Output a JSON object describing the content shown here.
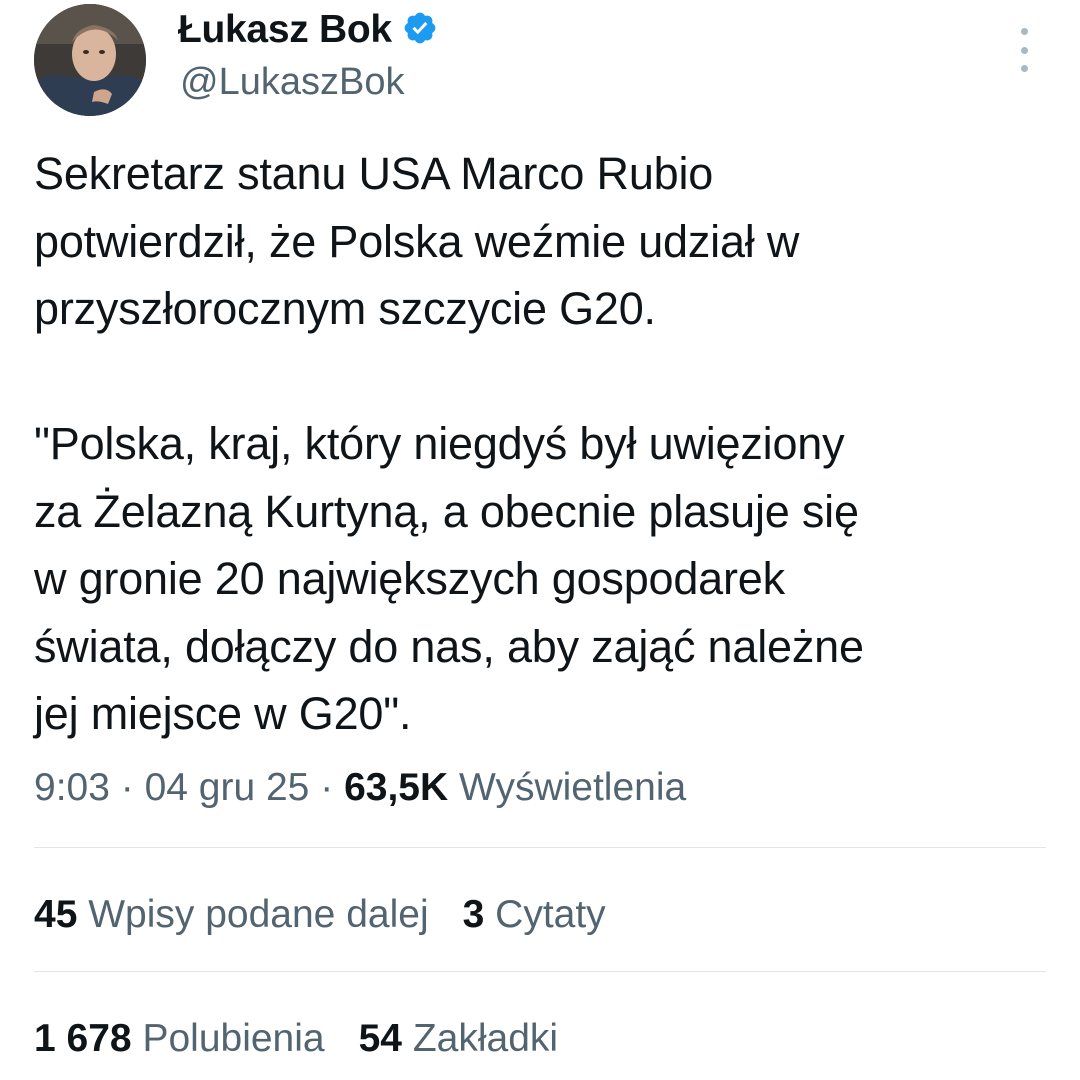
{
  "author": {
    "display_name": "Łukasz Bok",
    "handle": "@LukaszBok",
    "verified_icon": "verified-badge-icon",
    "avatar_icon": "profile-photo"
  },
  "menu": {
    "icon": "more-vertical-icon"
  },
  "tweet": {
    "text": "Sekretarz stanu USA Marco Rubio\npotwierdził, że Polska weźmie udział w\nprzyszłorocznym szczycie G20.\n\n\"Polska, kraj, który niegdyś był uwięziony\nza Żelazną Kurtyną, a obecnie plasuje się\nw gronie 20 największych gospodarek\nświata, dołączy do nas, aby zająć należne\njej miejsce w G20\"."
  },
  "meta": {
    "time": "9:03",
    "separator": " · ",
    "date": "04 gru 25",
    "views_count": "63,5K",
    "views_label": "Wyświetlenia"
  },
  "stats": {
    "reposts_count": "45",
    "reposts_label": "Wpisy podane dalej",
    "quotes_count": "3",
    "quotes_label": "Cytaty",
    "likes_count": "1 678",
    "likes_label": "Polubienia",
    "bookmarks_count": "54",
    "bookmarks_label": "Zakładki"
  },
  "colors": {
    "text_primary": "#0f1419",
    "text_secondary": "#536471",
    "verified_blue": "#1d9bf0",
    "divider": "#e1e6ea"
  }
}
